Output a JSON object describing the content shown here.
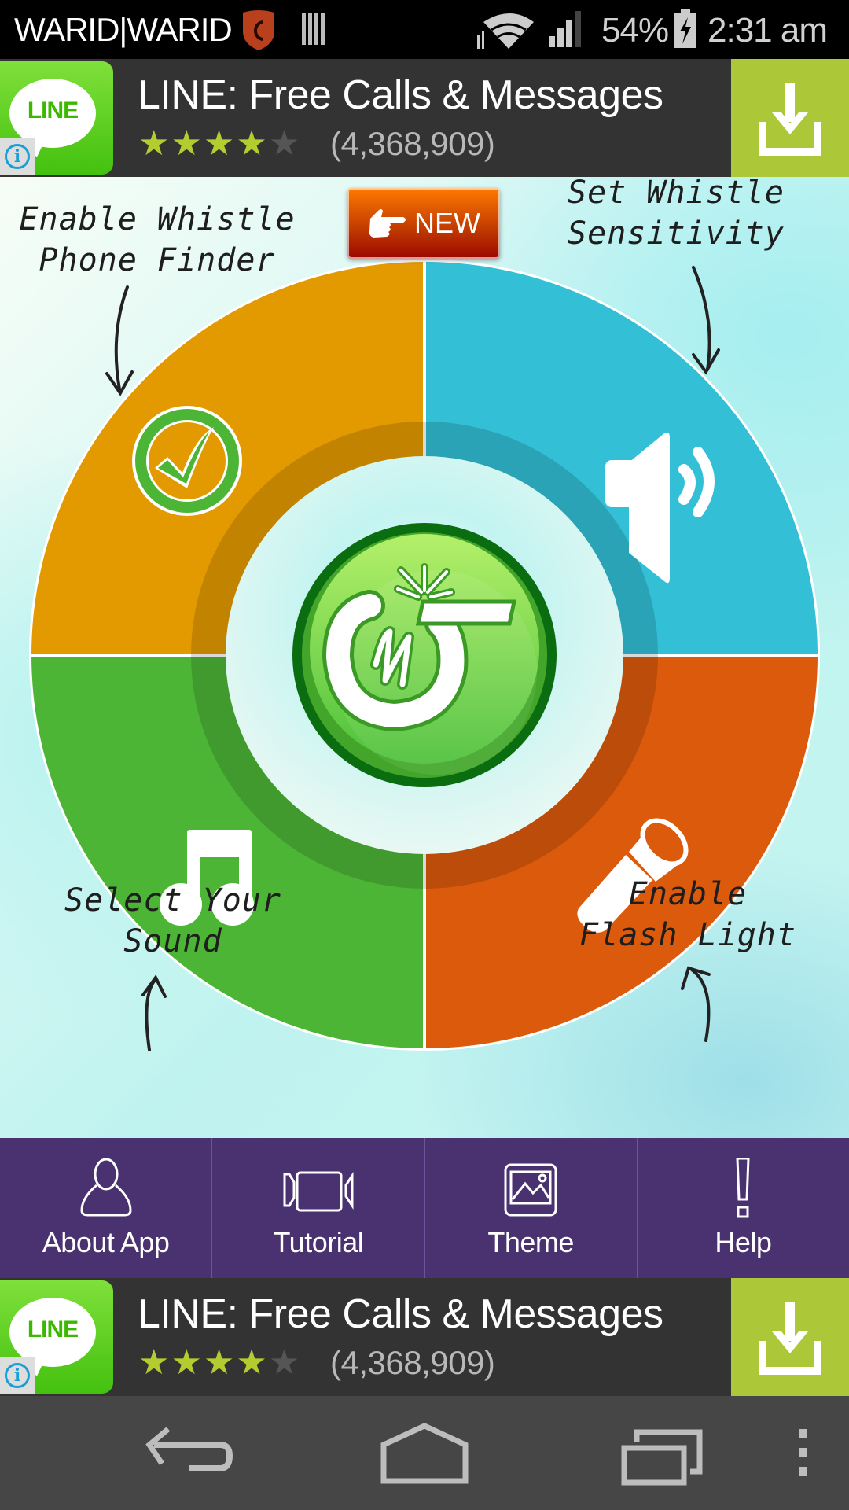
{
  "status_bar": {
    "carrier": "WARID|WARID",
    "battery_percent": "54%",
    "time": "2:31 am",
    "icons": [
      "security-shield-icon",
      "barcode-icon",
      "wifi-icon",
      "cell-signal-icon",
      "battery-charging-icon"
    ]
  },
  "ads": [
    {
      "app_name": "LINE: Free Calls & Messages",
      "logo_text": "LINE",
      "rating_stars": 4,
      "rating_max": 5,
      "rating_count": "(4,368,909)",
      "info_glyph": "i",
      "download_icon": "download-icon"
    },
    {
      "app_name": "LINE: Free Calls & Messages",
      "logo_text": "LINE",
      "rating_stars": 4,
      "rating_max": 5,
      "rating_count": "(4,368,909)",
      "info_glyph": "i",
      "download_icon": "download-icon"
    }
  ],
  "main": {
    "new_badge": "NEW",
    "labels": {
      "enable_whistle_line1": "Enable Whistle",
      "enable_whistle_line2": "Phone Finder",
      "sensitivity_line1": "Set Whistle",
      "sensitivity_line2": "Sensitivity",
      "sound_line1": "Select Your",
      "sound_line2": "Sound",
      "flash_line1": "Enable",
      "flash_line2": "Flash Light"
    },
    "segments": [
      {
        "name": "enable-whistle",
        "icon": "check-circle-icon",
        "color": "#e39a00"
      },
      {
        "name": "sensitivity",
        "icon": "speaker-icon",
        "color": "#33c0d6"
      },
      {
        "name": "flash-light",
        "icon": "flashlight-icon",
        "color": "#dc5a0c"
      },
      {
        "name": "select-sound",
        "icon": "music-note-icon",
        "color": "#4db535"
      }
    ],
    "center_button_icon": "whistle-logo-icon"
  },
  "nav": {
    "items": [
      {
        "label": "About App",
        "icon": "person-icon"
      },
      {
        "label": "Tutorial",
        "icon": "video-camera-icon"
      },
      {
        "label": "Theme",
        "icon": "image-icon"
      },
      {
        "label": "Help",
        "icon": "exclamation-icon"
      }
    ]
  },
  "colors": {
    "nav_bg": "#4a3270",
    "ad_bg": "#333333",
    "ad_download_bg": "#acc737",
    "star_filled": "#b5cc30",
    "star_empty": "#555555"
  }
}
